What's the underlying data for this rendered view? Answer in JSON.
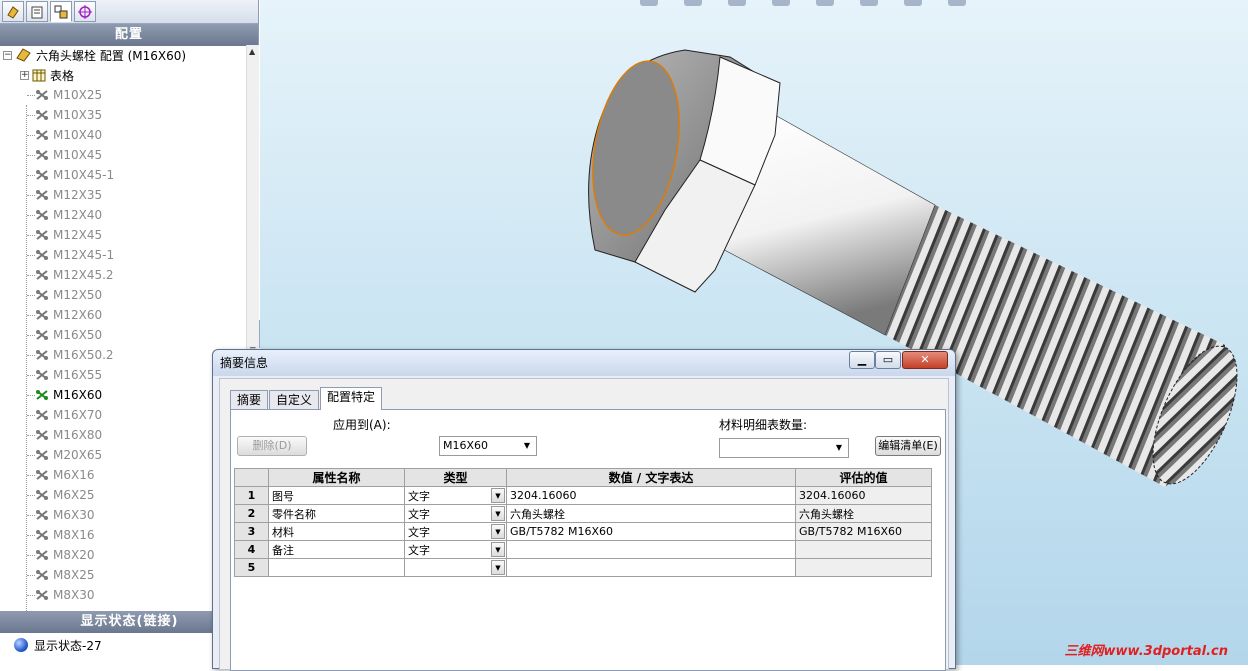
{
  "left_panel": {
    "config_header": "配置",
    "root_label": "六角头螺栓 配置  (M16X60)",
    "table_label": "表格",
    "configs": [
      "M10X25",
      "M10X35",
      "M10X40",
      "M10X45",
      "M10X45-1",
      "M12X35",
      "M12X40",
      "M12X45",
      "M12X45-1",
      "M12X45.2",
      "M12X50",
      "M12X60",
      "M16X50",
      "M16X50.2",
      "M16X55",
      "M16X60",
      "M16X70",
      "M16X80",
      "M20X65",
      "M6X16",
      "M6X25",
      "M6X30",
      "M8X16",
      "M8X20",
      "M8X25",
      "M8X30"
    ],
    "active_config": "M16X60",
    "display_state_header": "显示状态(链接)",
    "display_state_item": "显示状态-27"
  },
  "dialog": {
    "title": "摘要信息",
    "tabs": [
      "摘要",
      "自定义",
      "配置特定"
    ],
    "active_tab": "配置特定",
    "apply_to_label": "应用到(A):",
    "apply_to_value": "M16X60",
    "delete_button": "删除(D)",
    "bom_qty_label": "材料明细表数量:",
    "bom_qty_value": "",
    "edit_list_button": "编辑清单(E)",
    "grid": {
      "headers": [
        "属性名称",
        "类型",
        "数值 / 文字表达",
        "评估的值"
      ],
      "rows": [
        {
          "num": "1",
          "name": "图号",
          "type": "文字",
          "value": "3204.16060",
          "eval": "3204.16060"
        },
        {
          "num": "2",
          "name": "零件名称",
          "type": "文字",
          "value": "六角头螺栓",
          "eval": "六角头螺栓"
        },
        {
          "num": "3",
          "name": "材料",
          "type": "文字",
          "value": "GB/T5782 M16X60",
          "eval": "GB/T5782 M16X60"
        },
        {
          "num": "4",
          "name": "备注",
          "type": "文字",
          "value": "",
          "eval": ""
        },
        {
          "num": "5",
          "name": "",
          "type": "",
          "value": "",
          "eval": ""
        }
      ]
    }
  },
  "viewport": {
    "watermark": "三维网www.3dportal.cn"
  },
  "colors": {
    "accent": "#6b778e",
    "viewport_bg": "#cde6f3",
    "watermark": "#e02020"
  }
}
